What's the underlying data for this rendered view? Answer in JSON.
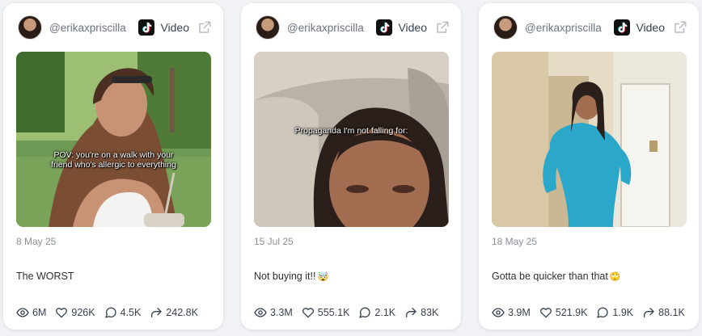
{
  "cards": [
    {
      "username": "@erikaxpriscilla",
      "platform": "Video",
      "overlay_text": "POV: you're on a walk with your friend who's allergic to everything",
      "date": "8 May 25",
      "caption": "The WORST",
      "stats": {
        "views": "6M",
        "likes": "926K",
        "comments": "4.5K",
        "shares": "242.8K"
      }
    },
    {
      "username": "@erikaxpriscilla",
      "platform": "Video",
      "overlay_text": "Propaganda I'm not falling for:",
      "date": "15 Jul 25",
      "caption": "Not buying it!!",
      "caption_emoji": "🤯",
      "stats": {
        "views": "3.3M",
        "likes": "555.1K",
        "comments": "2.1K",
        "shares": "83K"
      }
    },
    {
      "username": "@erikaxpriscilla",
      "platform": "Video",
      "date": "18 May 25",
      "caption": "Gotta be quicker than that",
      "caption_emoji": "🙄",
      "stats": {
        "views": "3.9M",
        "likes": "521.9K",
        "comments": "1.9K",
        "shares": "88.1K"
      }
    }
  ],
  "icons": {
    "platform": "tiktok-icon",
    "external": "external-link-icon",
    "views": "eye-icon",
    "likes": "heart-icon",
    "comments": "comment-icon",
    "shares": "share-icon"
  }
}
